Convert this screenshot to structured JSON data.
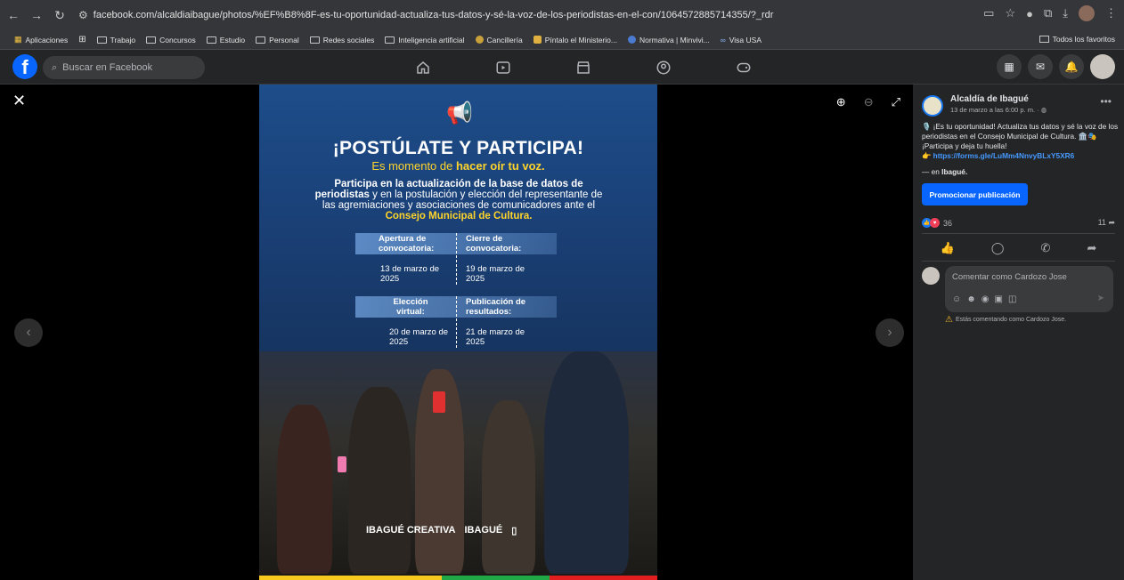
{
  "browser": {
    "url": "facebook.com/alcaldiaibague/photos/%EF%B8%8F-es-tu-oportunidad-actualiza-tus-datos-y-sé-la-voz-de-los-periodistas-en-el-con/1064572885714355/?_rdr",
    "bookmarks": [
      "Aplicaciones",
      "Trabajo",
      "Concursos",
      "Estudio",
      "Personal",
      "Redes sociales",
      "Inteligencia artificial",
      "Cancillería",
      "Píntalo el Ministerio...",
      "Normativa | Minvivi...",
      "Visa USA"
    ],
    "all_bookmarks": "Todos los favoritos"
  },
  "facebook": {
    "search_placeholder": "Buscar en Facebook"
  },
  "poster": {
    "title": "¡POSTÚLATE Y PARTICIPA!",
    "subtitle_a": "Es momento de ",
    "subtitle_b": "hacer oír tu voz.",
    "body_a": "Participa en la actualización de la base de datos de periodistas",
    "body_b": " y en la postulación y elección del representante de las agremiaciones y asociaciones de comunicadores ante el ",
    "body_c": "Consejo Municipal de Cultura.",
    "apertura_label": "Apertura de convocatoria:",
    "cierre_label": "Cierre de convocatoria:",
    "apertura_date": "13 de marzo de 2025",
    "cierre_date": "19 de marzo de 2025",
    "eleccion_label": "Elección virtual:",
    "publicacion_label": "Publicación de resultados:",
    "eleccion_date": "20 de marzo de 2025",
    "publicacion_date": "21 de marzo de 2025",
    "logo_1": "IBAGUÉ CREATIVA",
    "logo_2": "IBAGUÉ"
  },
  "post": {
    "page_name": "Alcaldía de Ibagué",
    "timestamp": "13 de marzo a las 6:00 p. m. ·",
    "text": "🎙️ ¡Es tu oportunidad! Actualiza tus datos y sé la voz de los periodistas en el Consejo Municipal de Cultura. 🏛️🎭 ¡Participa y deja tu huella!",
    "link": "https://forms.gle/LuMm4NnvyBLxY5XR6",
    "location_prefix": "— en ",
    "location": "Ibagué.",
    "promote_label": "Promocionar publicación",
    "reaction_count": "36",
    "share_count": "11",
    "comment_placeholder": "Comentar como Cardozo Jose",
    "warning": "Estás comentando como Cardozo Jose."
  }
}
